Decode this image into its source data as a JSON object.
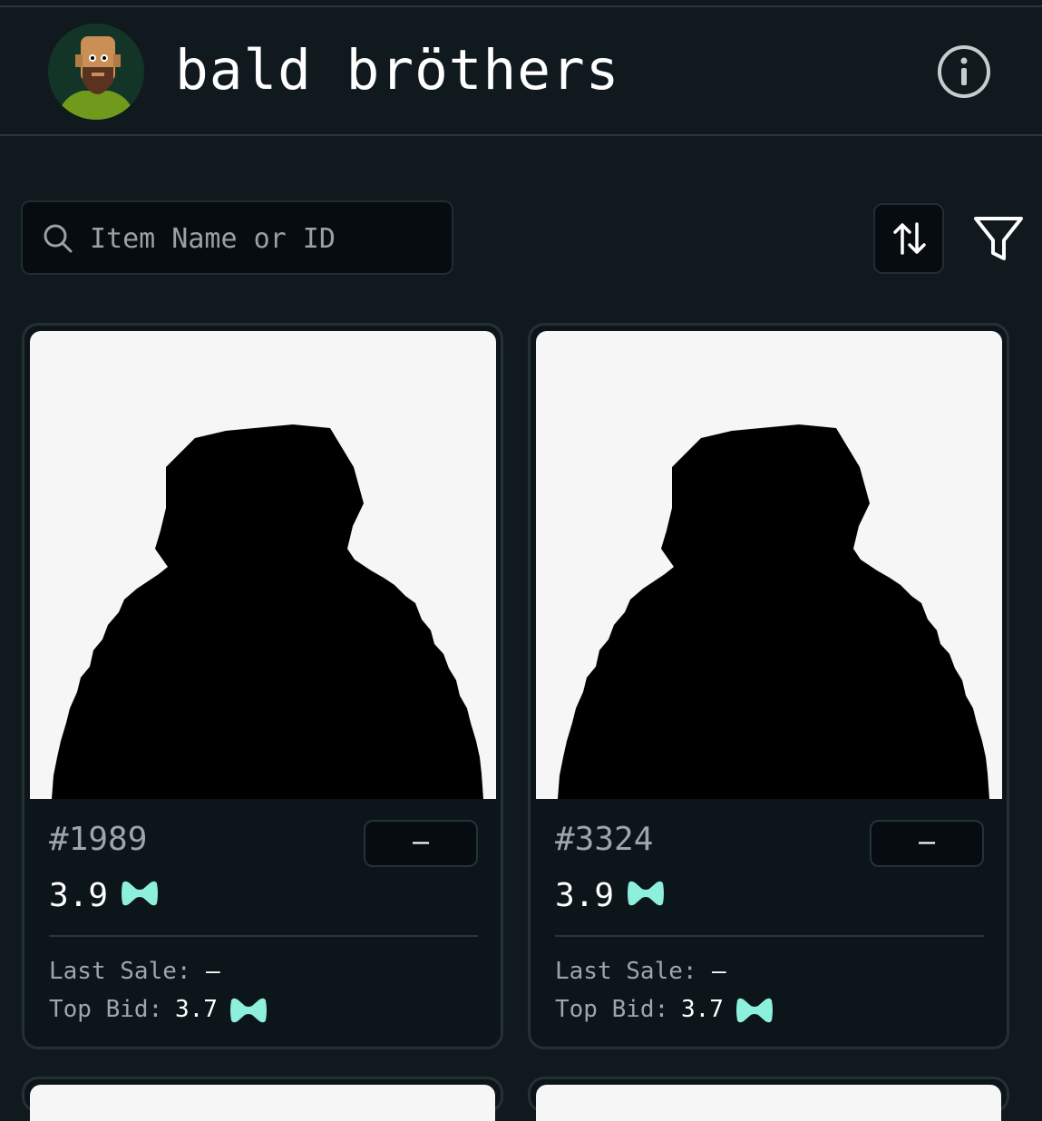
{
  "header": {
    "title": "bald bröthers",
    "avatar_icon": "bald-man-avatar-icon",
    "info_icon": "info-icon"
  },
  "search": {
    "placeholder": "Item Name or ID",
    "icon": "search-icon"
  },
  "toolbar": {
    "sort_icon": "sort-arrows-icon",
    "filter_icon": "filter-icon"
  },
  "colors": {
    "background": "#101a1e",
    "card": "#0c151a",
    "accent_currency": "#8df0dc",
    "muted_text": "#9ea6ab"
  },
  "cards": [
    {
      "id": "#1989",
      "status": "–",
      "price": "3.9",
      "last_sale_label": "Last Sale:",
      "last_sale": "–",
      "top_bid_label": "Top Bid:",
      "top_bid": "3.7"
    },
    {
      "id": "#3324",
      "status": "–",
      "price": "3.9",
      "last_sale_label": "Last Sale:",
      "last_sale": "–",
      "top_bid_label": "Top Bid:",
      "top_bid": "3.7"
    }
  ]
}
